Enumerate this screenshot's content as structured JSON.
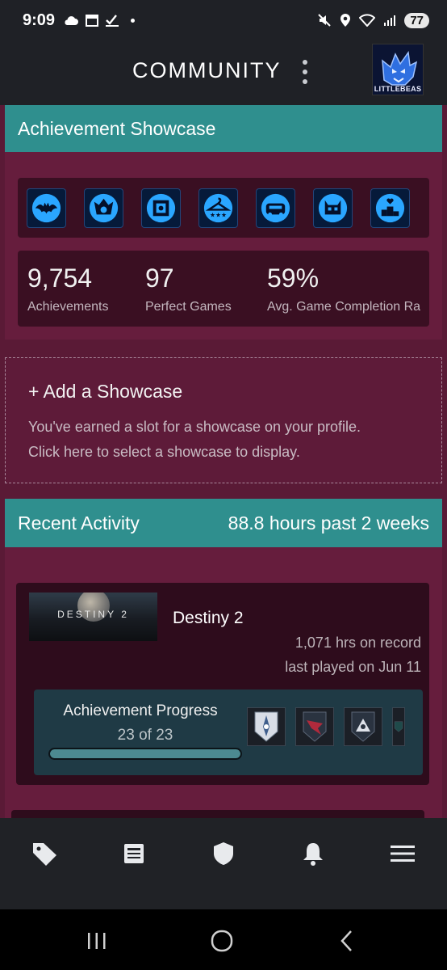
{
  "status_bar": {
    "time": "9:09",
    "battery": "77"
  },
  "header": {
    "title": "COMMUNITY",
    "avatar_text": "LITTLEBEAS"
  },
  "achievement_showcase": {
    "title": "Achievement Showcase",
    "badges": [
      "bat-icon",
      "emblem-icon",
      "vault-icon",
      "hanger-stars-icon",
      "car-icon",
      "helmet-icon",
      "podium-heart-icon"
    ],
    "stats": [
      {
        "value": "9,754",
        "label": "Achievements"
      },
      {
        "value": "97",
        "label": "Perfect Games"
      },
      {
        "value": "59%",
        "label": "Avg. Game Completion Ra"
      }
    ]
  },
  "add_showcase": {
    "title": "+ Add a Showcase",
    "line1": "You've earned a slot for a showcase on your profile.",
    "line2": "Click here to select a showcase to display."
  },
  "recent_activity": {
    "title": "Recent Activity",
    "summary": "88.8 hours past 2 weeks",
    "games": [
      {
        "name": "Destiny 2",
        "thumb_text": "DESTINY 2",
        "hours": "1,071 hrs on record",
        "last_played": "last played on Jun 11",
        "progress_title": "Achievement Progress",
        "progress_count": "23 of 23",
        "progress_fraction": 1.0
      }
    ]
  },
  "bottom_nav": [
    "tag-icon",
    "news-icon",
    "shield-icon",
    "bell-icon",
    "menu-icon"
  ],
  "colors": {
    "panel_header": "#2f8f8e",
    "background": "#5a1a36",
    "progress_box": "#1f3a45"
  }
}
